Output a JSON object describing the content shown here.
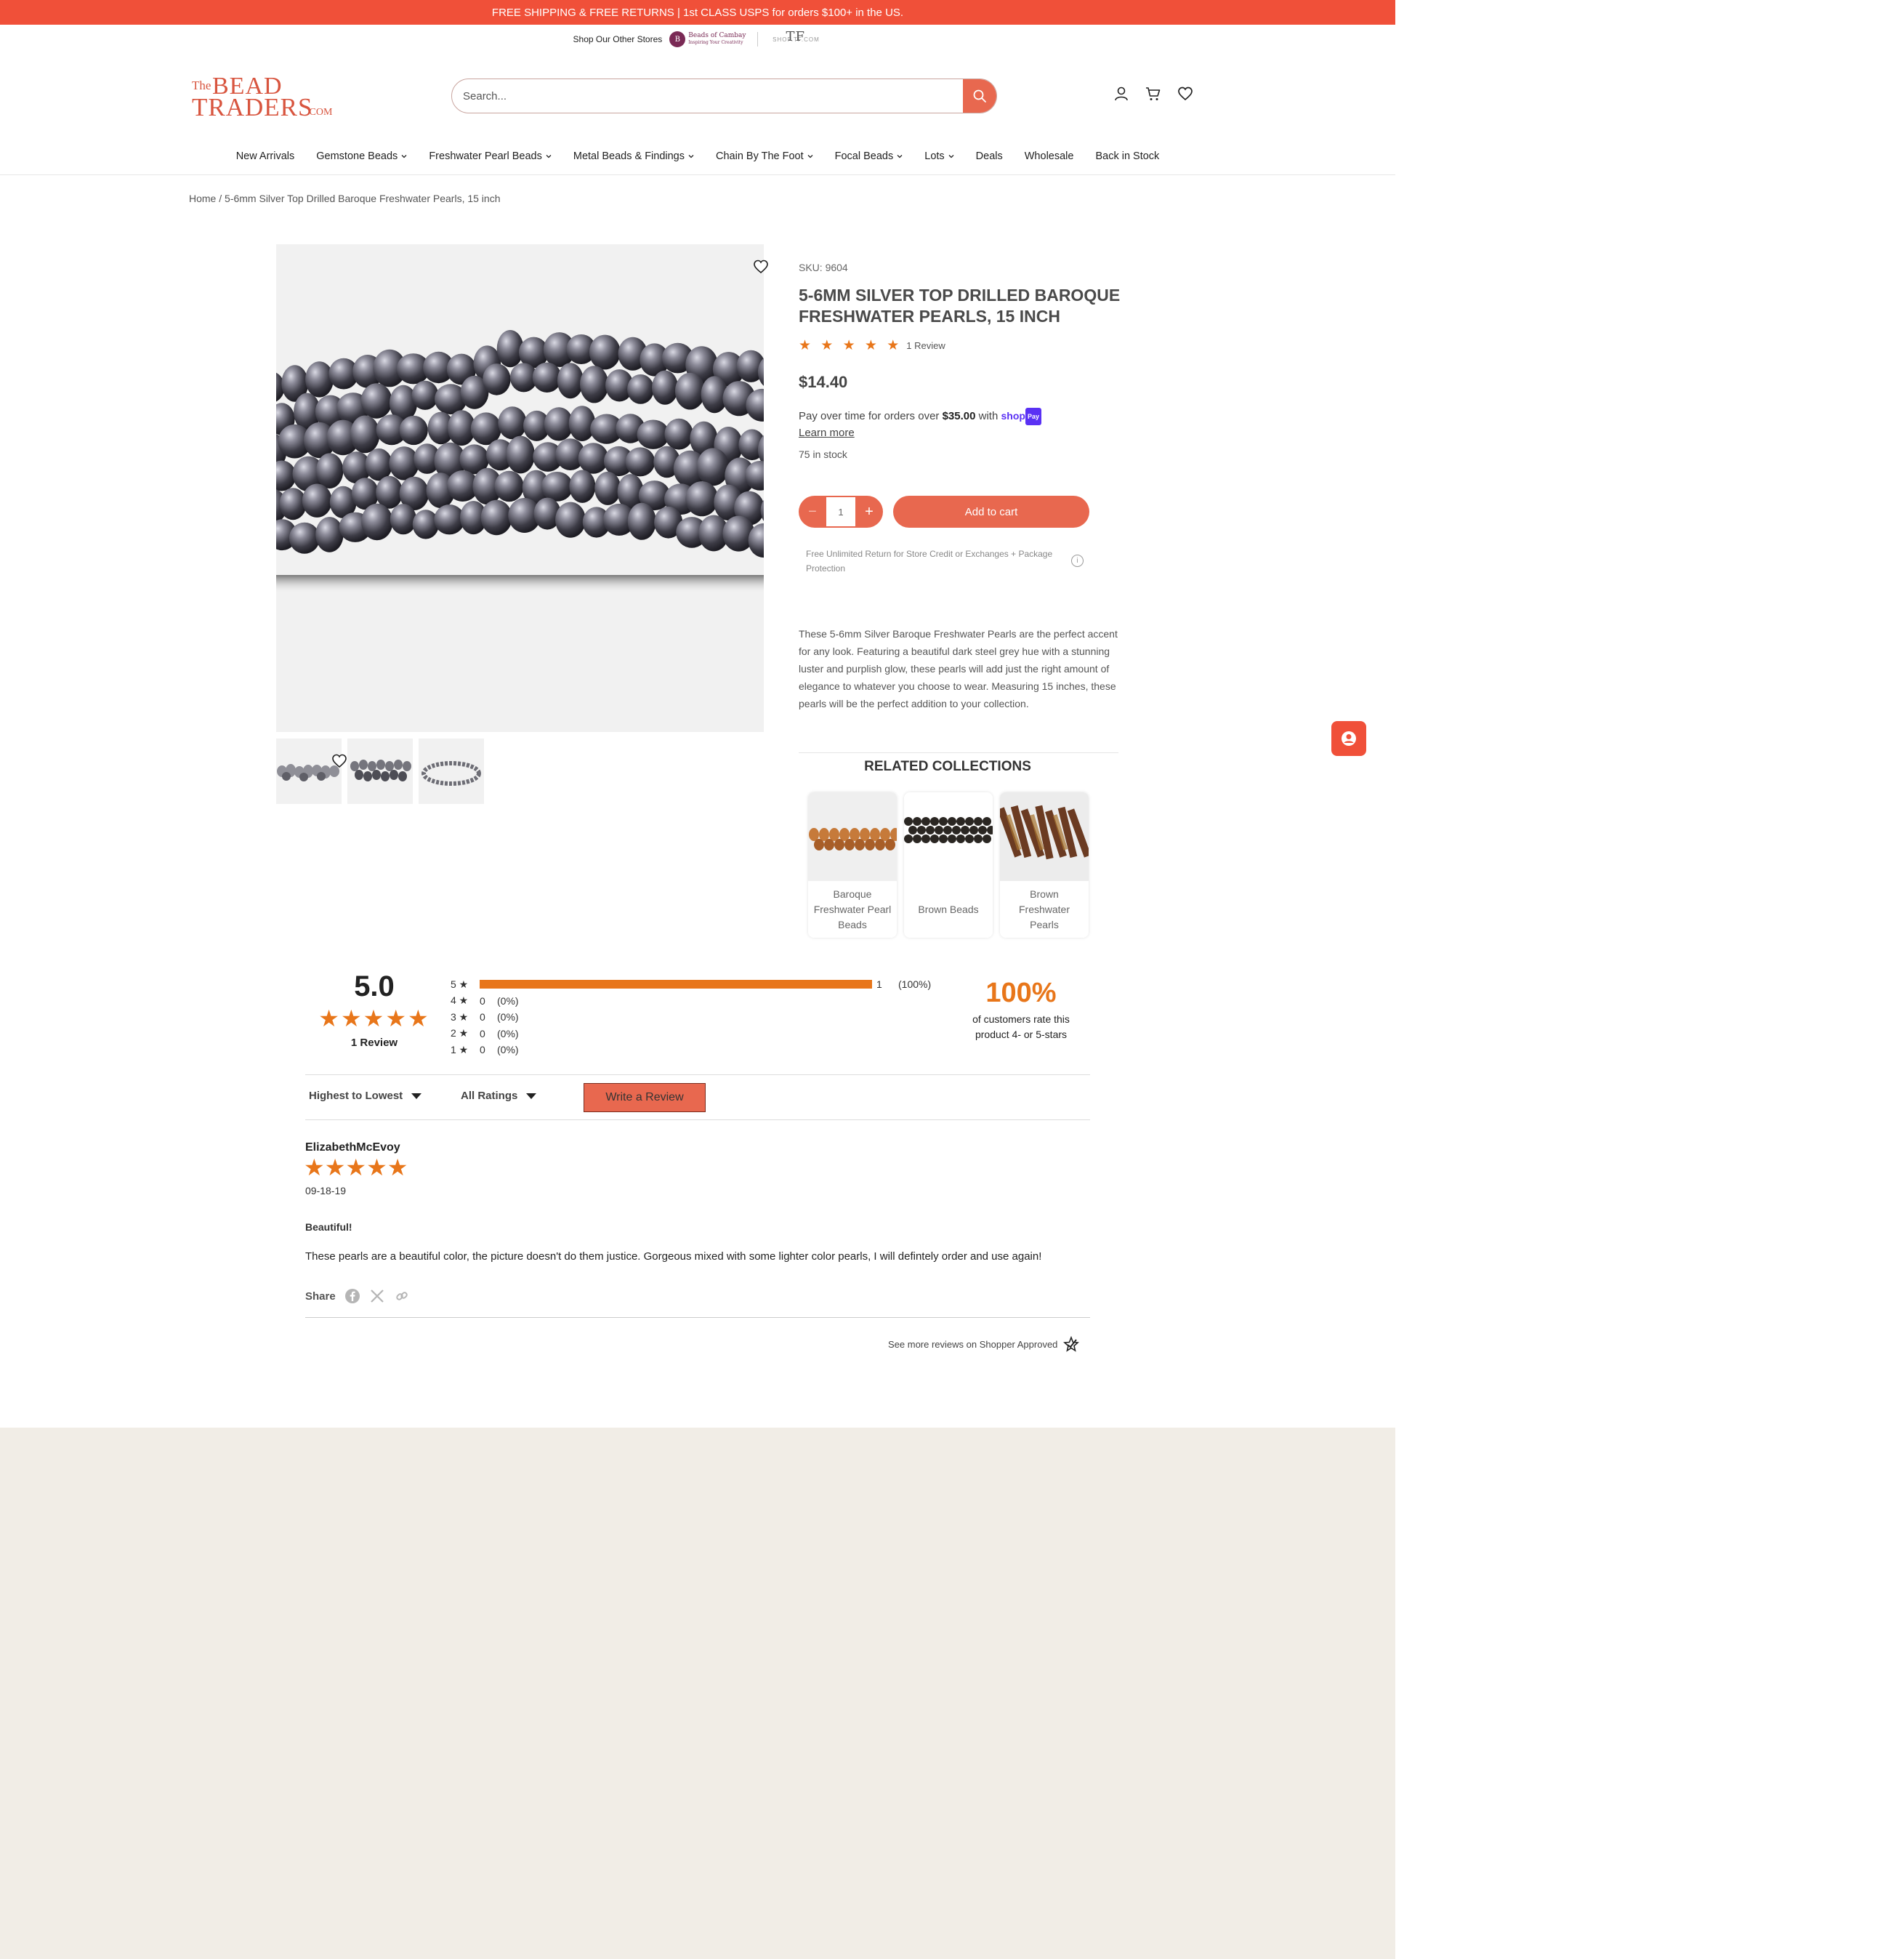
{
  "announcement": "FREE SHIPPING & FREE RETURNS | 1st CLASS USPS for orders $100+ in the US.",
  "stores": {
    "label": "Shop Our Other Stores",
    "store1_name": "Beads of Cambay",
    "store1_tagline": "Inspiring Your Creativity",
    "store2_name": "SHOP.TF.COM"
  },
  "logo": {
    "the": "The",
    "bead": "BEAD",
    "traders": "TRADERS",
    "com": ".COM"
  },
  "search": {
    "placeholder": "Search..."
  },
  "header_icons": [
    "account-icon",
    "cart-icon",
    "wishlist-heart-icon"
  ],
  "nav": [
    {
      "label": "New Arrivals",
      "dropdown": false
    },
    {
      "label": "Gemstone Beads",
      "dropdown": true
    },
    {
      "label": "Freshwater Pearl Beads",
      "dropdown": true
    },
    {
      "label": "Metal Beads & Findings",
      "dropdown": true
    },
    {
      "label": "Chain By The Foot",
      "dropdown": true
    },
    {
      "label": "Focal Beads",
      "dropdown": true
    },
    {
      "label": "Lots",
      "dropdown": true
    },
    {
      "label": "Deals",
      "dropdown": false
    },
    {
      "label": "Wholesale",
      "dropdown": false
    },
    {
      "label": "Back in Stock",
      "dropdown": false
    }
  ],
  "breadcrumb": {
    "home": "Home",
    "sep": " / ",
    "current": "5-6mm Silver Top Drilled Baroque Freshwater Pearls, 15 inch"
  },
  "product": {
    "sku": "SKU: 9604",
    "title": "5-6mm Silver Top Drilled Baroque Freshwater Pearls, 15 inch",
    "stars": "★ ★ ★ ★ ★",
    "rating": 5,
    "review_count": "1 Review",
    "price": "$14.40",
    "pay_over_prefix": "Pay over time for orders over ",
    "pay_over_amount": "$35.00",
    "pay_over_suffix": " with ",
    "shop_pay": "shop",
    "shop_pay_badge": "Pay",
    "learn_more": "Learn more",
    "stock": "75 in stock",
    "qty_minus": "−",
    "qty_value": "1",
    "qty_plus": "+",
    "add_to_cart": "Add to cart",
    "returns_note": "Free Unlimited Return for Store Credit or Exchanges + Package Protection",
    "info_icon": "i",
    "description": "These 5-6mm Silver Baroque Freshwater Pearls are the perfect accent for any look. Featuring a beautiful dark steel grey hue with a stunning luster and purplish glow, these pearls will add just the right amount of elegance to whatever you choose to wear. Measuring 15 inches, these pearls will be the perfect addition to your collection."
  },
  "related": {
    "title": "RELATED COLLECTIONS",
    "items": [
      {
        "label": "Baroque Freshwater Pearl Beads"
      },
      {
        "label": "Brown Beads"
      },
      {
        "label": "Brown Freshwater Pearls"
      }
    ]
  },
  "reviews": {
    "average": "5.0",
    "stars": "★★★★★",
    "total": "1 Review",
    "distribution": [
      {
        "label": "5 ★",
        "count": "1",
        "pct": "(100%)",
        "fraction": 1.0
      },
      {
        "label": "4 ★",
        "count": "0",
        "pct": "(0%)",
        "fraction": 0
      },
      {
        "label": "3 ★",
        "count": "0",
        "pct": "(0%)",
        "fraction": 0
      },
      {
        "label": "2 ★",
        "count": "0",
        "pct": "(0%)",
        "fraction": 0
      },
      {
        "label": "1 ★",
        "count": "0",
        "pct": "(0%)",
        "fraction": 0
      }
    ],
    "recommend_pct": "100%",
    "recommend_text": "of customers rate this product 4- or 5-stars",
    "sort_label": "Highest to Lowest",
    "filter_label": "All Ratings",
    "write_review": "Write a Review",
    "items": [
      {
        "author": "ElizabethMcEvoy",
        "stars": "★★★★★",
        "date": "09-18-19",
        "headline": "Beautiful!",
        "body": "These pearls are a beautiful color, the picture doesn't do them justice. Gorgeous mixed with some lighter color pearls, I will defintely order and use again!"
      }
    ],
    "share_label": "Share",
    "see_more": "See more reviews on Shopper Approved"
  },
  "colors": {
    "accent": "#f05039",
    "button": "#e8684f",
    "star": "#e8761a",
    "footer": "#f1ede6"
  }
}
